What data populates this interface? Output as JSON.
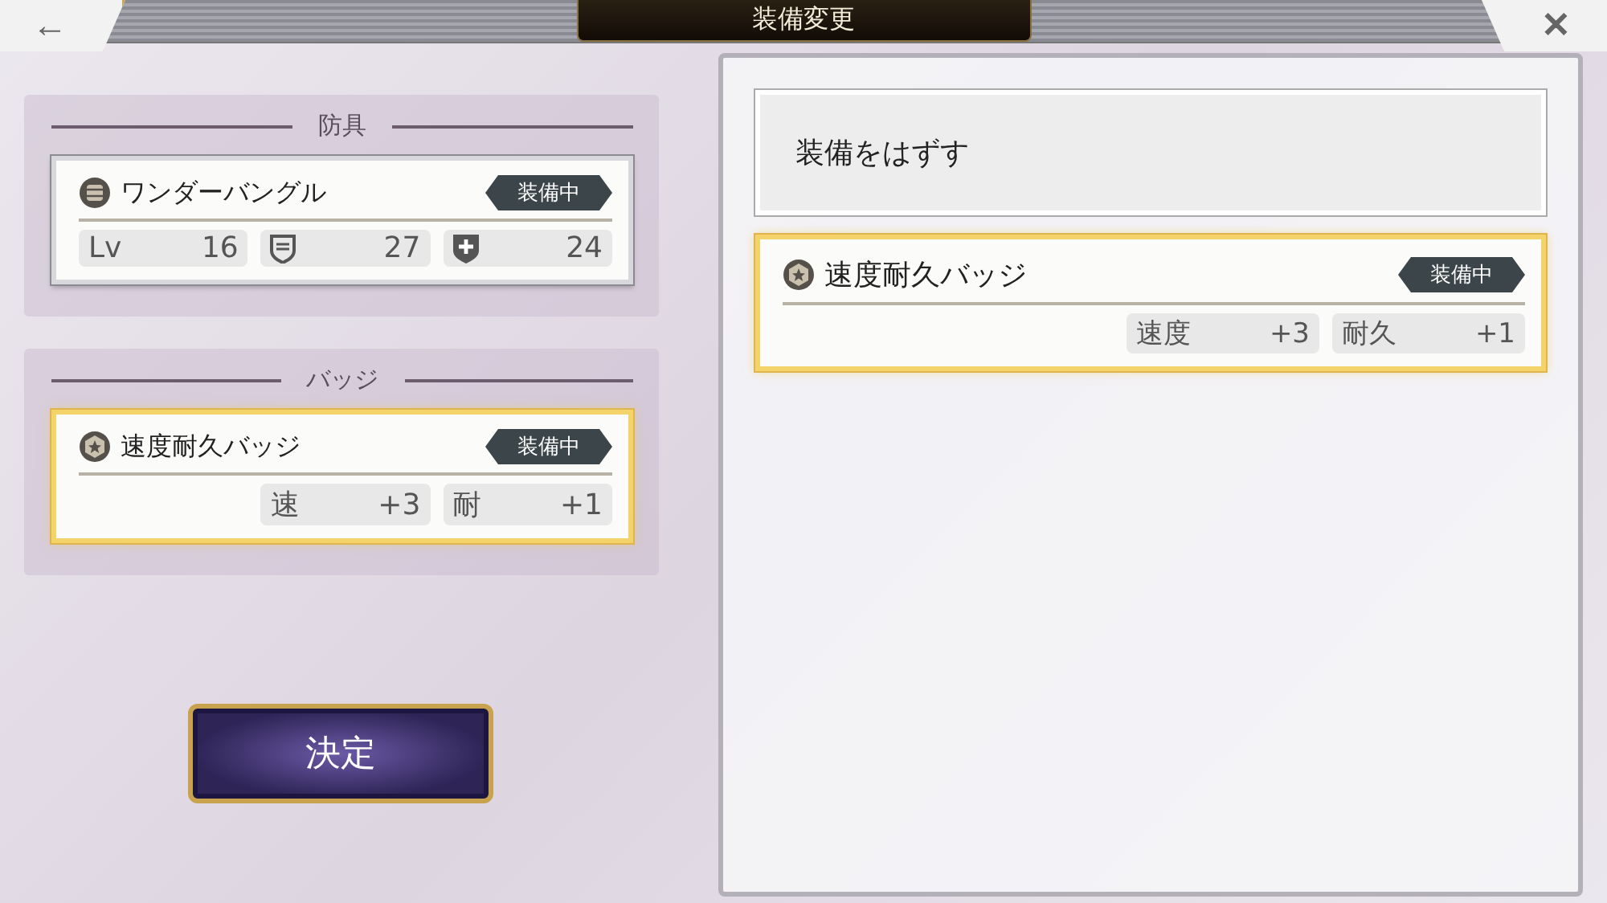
{
  "header": {
    "back_button": "←",
    "title": "装備変更",
    "close_button": "✕"
  },
  "sections": [
    {
      "heading": "防具",
      "items": [
        {
          "kind": "armor",
          "name": "ワンダーバングル",
          "badge": "装備中",
          "selected": false,
          "stats": [
            {
              "kind": "level",
              "label": "Lv",
              "value": "16"
            },
            {
              "kind": "defense",
              "value": "27"
            },
            {
              "kind": "resist",
              "value": "24"
            }
          ]
        }
      ]
    },
    {
      "heading": "バッジ",
      "items": [
        {
          "kind": "badge",
          "name": "速度耐久バッジ",
          "badge": "装備中",
          "selected": true,
          "stats": [
            {
              "kind": "text",
              "label": "速",
              "value": "+3"
            },
            {
              "kind": "text",
              "label": "耐",
              "value": "+1"
            }
          ]
        }
      ]
    }
  ],
  "confirm_button": "決定",
  "list": {
    "unequip_button": "装備をはずす",
    "items": [
      {
        "kind": "badge",
        "name": "速度耐久バッジ",
        "badge": "装備中",
        "selected": true,
        "stats": [
          {
            "kind": "text",
            "label": "速度",
            "value": "+3"
          },
          {
            "kind": "text",
            "label": "耐久",
            "value": "+1"
          }
        ]
      }
    ]
  }
}
